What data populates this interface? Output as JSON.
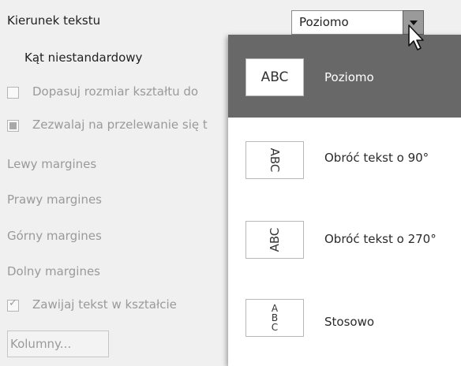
{
  "labels": {
    "kierunek": "Kierunek tekstu",
    "kat": "Kąt niestandardowy",
    "dopasuj": "Dopasuj rozmiar kształtu do",
    "zezwalaj": "Zezwalaj na przelewanie się t",
    "lewy": "Lewy margines",
    "prawy": "Prawy margines",
    "gorny": "Górny margines",
    "dolny": "Dolny margines",
    "zawijaj": "Zawijaj tekst w kształcie",
    "kolumny": "Kolumny..."
  },
  "combo": {
    "value": "Poziomo"
  },
  "dropdown": {
    "items": [
      {
        "thumb": "ABC",
        "label": "Poziomo"
      },
      {
        "thumb": "ABC",
        "label": "Obróć tekst o 90°"
      },
      {
        "thumb": "ABC",
        "label": "Obróć tekst o 270°"
      },
      {
        "thumb": "A\nB\nC",
        "label": "Stosowo"
      }
    ]
  },
  "colors": {
    "selected_bg": "#686868",
    "disabled_text": "#9a9a9a",
    "panel_bg": "#f0f0f0"
  },
  "icons": [
    "dropdown-arrow-icon",
    "mouse-pointer-icon",
    "checkbox-icon",
    "checkmark-icon"
  ]
}
